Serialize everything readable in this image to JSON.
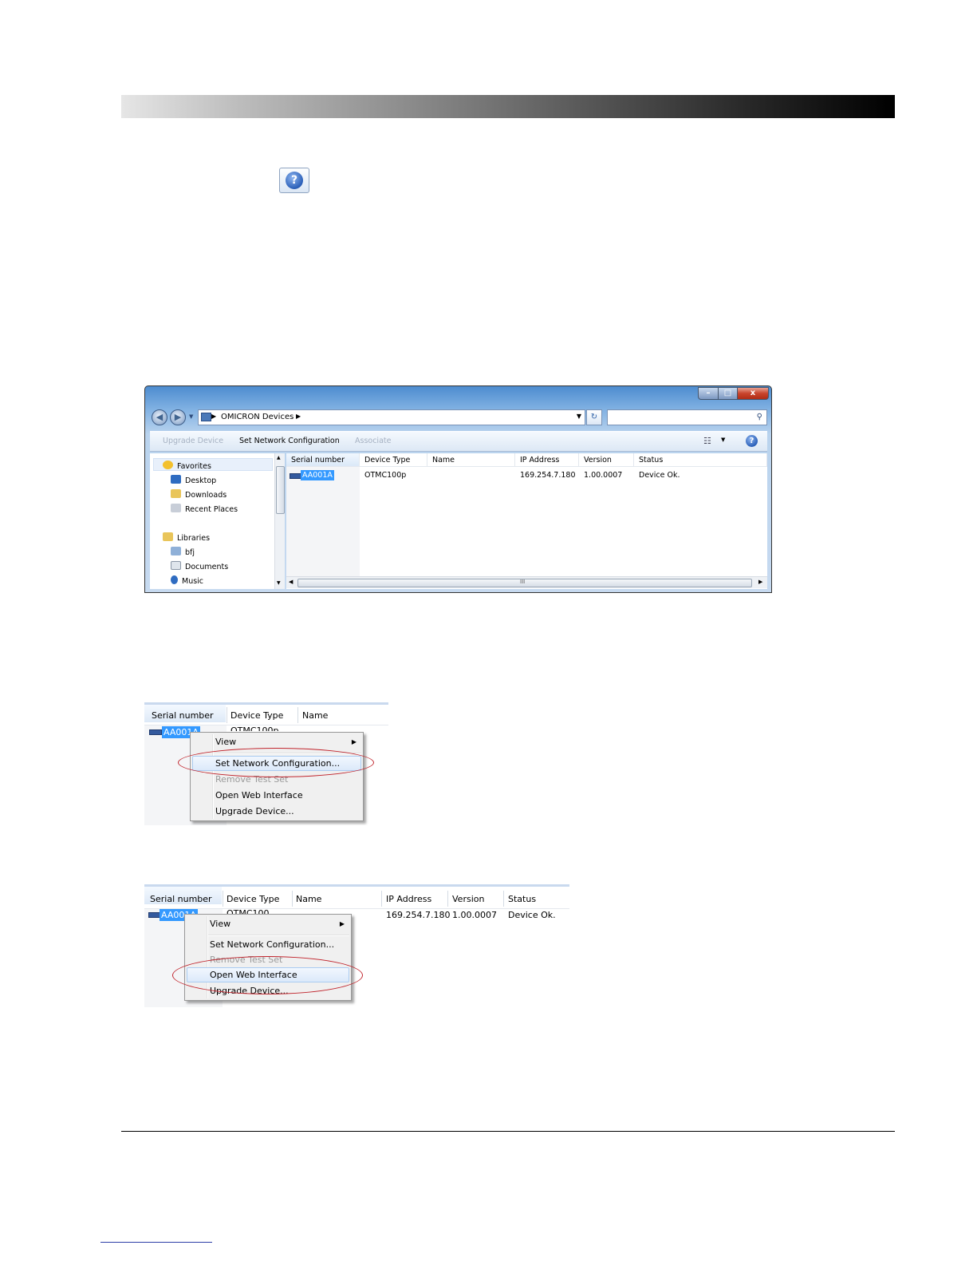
{
  "window": {
    "path": "OMICRON Devices",
    "minimize": "–",
    "maximize": "□",
    "close": "x",
    "toolbar": {
      "upgrade_device": "Upgrade Device",
      "set_network_configuration": "Set Network Configuration",
      "associate": "Associate"
    },
    "nav": {
      "favorites": "Favorites",
      "desktop": "Desktop",
      "downloads": "Downloads",
      "recent_places": "Recent Places",
      "libraries": "Libraries",
      "bfj": "bfj",
      "documents": "Documents",
      "music": "Music"
    },
    "columns": {
      "serial": "Serial number",
      "device_type": "Device Type",
      "name": "Name",
      "ip": "IP Address",
      "version": "Version",
      "status": "Status"
    },
    "row": {
      "serial": "AA001A",
      "device_type": "OTMC100p",
      "name": "",
      "ip": "169.254.7.180",
      "version": "1.00.0007",
      "status": "Device Ok."
    },
    "hscroll_grip": "III"
  },
  "menu1": {
    "view": "View",
    "set_network": "Set Network Configuration...",
    "remove_test_set": "Remove Test Set",
    "open_web": "Open Web Interface",
    "upgrade": "Upgrade Device...",
    "device_type_partial": "OTMC100p"
  },
  "menu2": {
    "view": "View",
    "set_network": "Set Network Configuration...",
    "remove_test_set": "Remove Test Set",
    "open_web": "Open Web Interface",
    "upgrade": "Upgrade Device...",
    "device_type_partial": "OTMC100"
  },
  "colors": {
    "selection": "#3399ff",
    "highlight_ellipse": "#c0242c",
    "window_chrome": "#4d8ccf"
  }
}
